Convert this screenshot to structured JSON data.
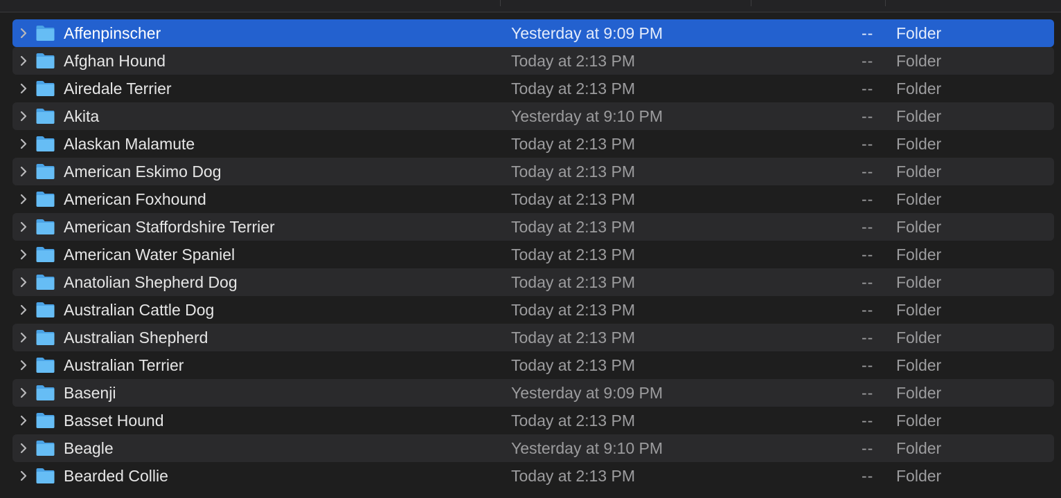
{
  "rows": [
    {
      "name": "Affenpinscher",
      "date": "Yesterday at 9:09 PM",
      "size": "--",
      "kind": "Folder"
    },
    {
      "name": "Afghan Hound",
      "date": "Today at 2:13 PM",
      "size": "--",
      "kind": "Folder"
    },
    {
      "name": "Airedale Terrier",
      "date": "Today at 2:13 PM",
      "size": "--",
      "kind": "Folder"
    },
    {
      "name": "Akita",
      "date": "Yesterday at 9:10 PM",
      "size": "--",
      "kind": "Folder"
    },
    {
      "name": "Alaskan Malamute",
      "date": "Today at 2:13 PM",
      "size": "--",
      "kind": "Folder"
    },
    {
      "name": "American Eskimo Dog",
      "date": "Today at 2:13 PM",
      "size": "--",
      "kind": "Folder"
    },
    {
      "name": "American Foxhound",
      "date": "Today at 2:13 PM",
      "size": "--",
      "kind": "Folder"
    },
    {
      "name": "American Staffordshire Terrier",
      "date": "Today at 2:13 PM",
      "size": "--",
      "kind": "Folder"
    },
    {
      "name": "American Water Spaniel",
      "date": "Today at 2:13 PM",
      "size": "--",
      "kind": "Folder"
    },
    {
      "name": "Anatolian Shepherd Dog",
      "date": "Today at 2:13 PM",
      "size": "--",
      "kind": "Folder"
    },
    {
      "name": "Australian Cattle Dog",
      "date": "Today at 2:13 PM",
      "size": "--",
      "kind": "Folder"
    },
    {
      "name": "Australian Shepherd",
      "date": "Today at 2:13 PM",
      "size": "--",
      "kind": "Folder"
    },
    {
      "name": "Australian Terrier",
      "date": "Today at 2:13 PM",
      "size": "--",
      "kind": "Folder"
    },
    {
      "name": "Basenji",
      "date": "Yesterday at 9:09 PM",
      "size": "--",
      "kind": "Folder"
    },
    {
      "name": "Basset Hound",
      "date": "Today at 2:13 PM",
      "size": "--",
      "kind": "Folder"
    },
    {
      "name": "Beagle",
      "date": "Yesterday at 9:10 PM",
      "size": "--",
      "kind": "Folder"
    },
    {
      "name": "Bearded Collie",
      "date": "Today at 2:13 PM",
      "size": "--",
      "kind": "Folder"
    }
  ],
  "selected_index": 0,
  "colors": {
    "selection": "#2361cf",
    "folder_icon": "#5fb6f2",
    "alt_row": "#2a2a2c",
    "background": "#1e1e1e"
  },
  "icons": {
    "disclosure": "chevron-right-icon",
    "item": "folder-icon"
  }
}
